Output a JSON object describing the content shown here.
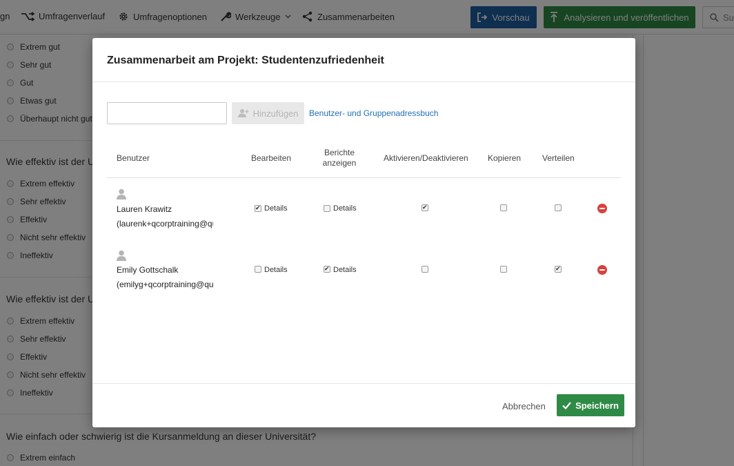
{
  "topbar": {
    "nav_partial": "gn",
    "history_label": "Umfragenverlauf",
    "options_label": "Umfragenoptionen",
    "tools_label": "Werkzeuge",
    "collaborate_label": "Zusammenarbeiten",
    "preview_label": "Vorschau",
    "publish_label": "Analysieren und veröffentlichen",
    "search_placeholder": "Su"
  },
  "survey": {
    "block1_options": [
      "Extrem gut",
      "Sehr gut",
      "Gut",
      "Etwas gut",
      "Überhaupt nicht gut"
    ],
    "question2": "Wie effektiv ist der U",
    "block2_options": [
      "Extrem effektiv",
      "Sehr effektiv",
      "Effektiv",
      "Nicht sehr effektiv",
      "Ineffektiv"
    ],
    "question3": "Wie effektiv ist der U",
    "block3_options": [
      "Extrem effektiv",
      "Sehr effektiv",
      "Effektiv",
      "Nicht sehr effektiv",
      "Ineffektiv"
    ],
    "question4": "Wie einfach oder schwierig ist die Kursanmeldung an dieser Universität?",
    "block4_options": [
      "Extrem einfach"
    ]
  },
  "modal": {
    "title": "Zusammenarbeit am Projekt: Studentenzufriedenheit",
    "add_input_value": "",
    "add_button_label": "Hinzufügen",
    "addressbook_link": "Benutzer- und Gruppenadressbuch",
    "columns": {
      "user": "Benutzer",
      "edit": "Bearbeiten",
      "reports_line1": "Berichte",
      "reports_line2": "anzeigen",
      "activate": "Aktivieren/Deaktivieren",
      "copy": "Kopieren",
      "distribute": "Verteilen"
    },
    "details_label": "Details",
    "users": [
      {
        "name": "Lauren Krawitz",
        "email": "(laurenk+qcorptraining@qua",
        "edit": true,
        "reports": false,
        "activate": true,
        "copy": false,
        "distribute": false
      },
      {
        "name": "Emily Gottschalk",
        "email": "(emilyg+qcorptraining@qua",
        "edit": false,
        "reports": true,
        "activate": false,
        "copy": false,
        "distribute": true
      }
    ],
    "cancel_label": "Abbrechen",
    "save_label": "Speichern"
  },
  "colors": {
    "primary_blue": "#1f5ea3",
    "action_green": "#2f8a45",
    "link_blue": "#1f6fb5",
    "remove_red": "#d9413b"
  }
}
